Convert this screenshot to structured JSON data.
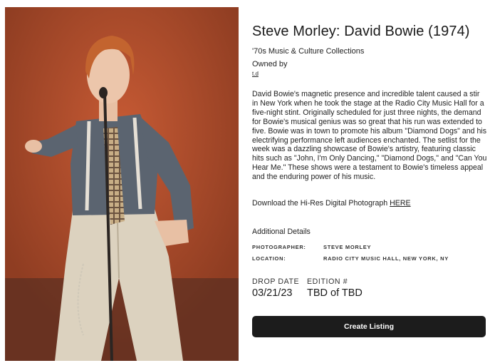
{
  "listing": {
    "title": "Steve Morley: David Bowie (1974)",
    "collection": "'70s Music & Culture Collections",
    "owned_by_label": "Owned by",
    "owner": "t.d",
    "description": "David Bowie's magnetic presence and incredible talent caused a stir in New York when he took the stage at the Radio City Music Hall for a five-night stint. Originally scheduled for just three nights, the demand for Bowie's musical genius was so great that his run was extended to five. Bowie was in town to promote his album \"Diamond Dogs\" and his electrifying performance left audiences enchanted. The setlist for the week was a dazzling showcase of Bowie's artistry, featuring classic hits such as \"John, I'm Only Dancing,\" \"Diamond Dogs,\" and \"Can You Hear Me.\" These shows were a testament to Bowie's timeless appeal and the enduring power of his music.",
    "download_text": "Download the Hi-Res Digital Photograph ",
    "download_link": "HERE"
  },
  "details": {
    "heading": "Additional Details",
    "rows": [
      {
        "key": "PHOTOGRAPHER:",
        "value": "STEVE MORLEY"
      },
      {
        "key": "LOCATION:",
        "value": "RADIO CITY MUSIC HALL, NEW YORK, NY"
      }
    ]
  },
  "meta": {
    "drop_date_label": "DROP DATE",
    "drop_date_value": "03/21/23",
    "edition_label": "EDITION #",
    "edition_value": "TBD of TBD"
  },
  "actions": {
    "create_listing": "Create Listing"
  },
  "photo": {
    "alt": "David Bowie performing on stage with microphone stand",
    "colors": {
      "background": "#a6492c",
      "shirt": "#5b6470",
      "trousers": "#dcd2bf",
      "tie": "#b59a78",
      "hair": "#c3642f"
    }
  }
}
